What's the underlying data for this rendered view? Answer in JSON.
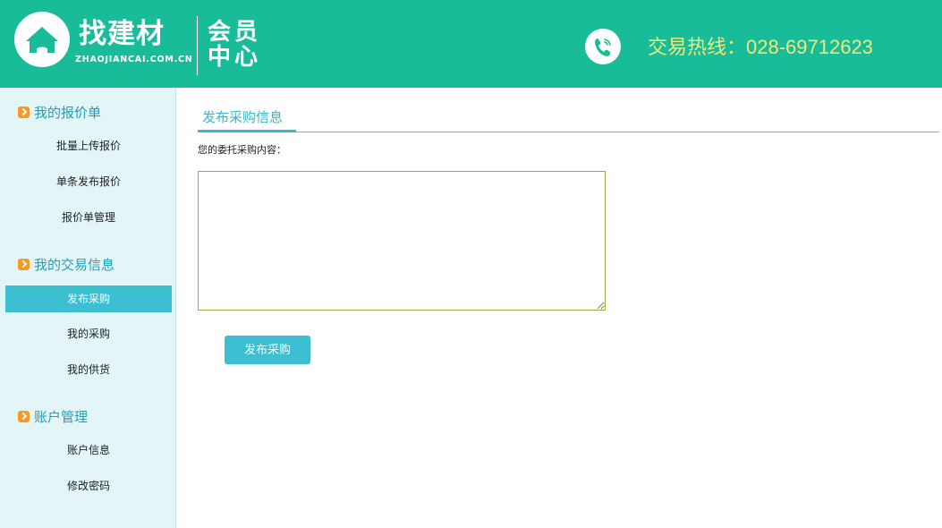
{
  "header": {
    "brand_name": "找建材",
    "brand_url": "ZHAOJIANCAI.COM.CN",
    "member_center_line1": "会员",
    "member_center_line2": "中心",
    "hotline": "交易热线：028-69712623",
    "icons": {
      "logo": "house-icon",
      "phone": "phone-icon"
    },
    "colors": {
      "header_bg": "#19bc99",
      "hotline_text": "#f1e87a"
    }
  },
  "sidebar": {
    "groups": [
      {
        "title": "我的报价单",
        "items": [
          {
            "label": "批量上传报价"
          },
          {
            "label": "单条发布报价"
          },
          {
            "label": "报价单管理"
          }
        ]
      },
      {
        "title": "我的交易信息",
        "items": [
          {
            "label": "发布采购",
            "active": true
          },
          {
            "label": "我的采购"
          },
          {
            "label": "我的供货"
          }
        ]
      },
      {
        "title": "账户管理",
        "items": [
          {
            "label": "账户信息"
          },
          {
            "label": "修改密码"
          }
        ]
      }
    ],
    "colors": {
      "bg": "#e3f5f7",
      "active_bg": "#3cbfd0",
      "group_title": "#1f9fb8",
      "group_icon": "#f59a23"
    }
  },
  "main": {
    "tab_title": "发布采购信息",
    "field_label": "您的委托采购内容：",
    "content_value": "",
    "submit_label": "发布采购",
    "colors": {
      "accent": "#3ab5c9",
      "textarea_border": "#a7a63a"
    }
  }
}
